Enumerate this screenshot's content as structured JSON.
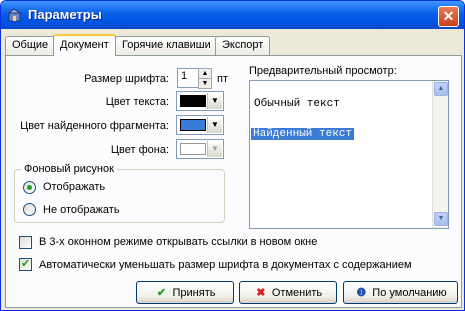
{
  "window": {
    "title": "Параметры",
    "close_icon": "✕"
  },
  "tabs": [
    {
      "label": "Общие",
      "active": false
    },
    {
      "label": "Документ",
      "active": true
    },
    {
      "label": "Горячие клавиши",
      "active": false
    },
    {
      "label": "Экспорт",
      "active": false
    }
  ],
  "font_size": {
    "label": "Размер шрифта:",
    "value": "1",
    "unit": "пт"
  },
  "colors": {
    "text_label": "Цвет текста:",
    "text_color": "#000000",
    "found_label": "Цвет найденного фрагмента:",
    "found_color": "#3a7bd5",
    "bg_label": "Цвет фона:",
    "bg_color": "#ffffff"
  },
  "background_image": {
    "legend": "Фоновый рисунок",
    "options": [
      {
        "label": "Отображать",
        "checked": true
      },
      {
        "label": "Не отображать",
        "checked": false
      }
    ]
  },
  "preview": {
    "label": "Предварительный просмотр:",
    "normal_text": "Обычный текст",
    "found_text": "Найденный текст"
  },
  "checkboxes": [
    {
      "label": "В 3-х оконном режиме открывать ссылки в новом окне",
      "checked": false
    },
    {
      "label": "Автоматически уменьшать размер шрифта в документах с содержанием",
      "checked": true
    }
  ],
  "buttons": {
    "accept": "Принять",
    "cancel": "Отменить",
    "default": "По умолчанию"
  },
  "accent_colors": {
    "title_bar": "#0054e3",
    "accept_icon": "#21a121",
    "cancel_icon": "#d42020",
    "default_icon": "#1f4fb0"
  }
}
